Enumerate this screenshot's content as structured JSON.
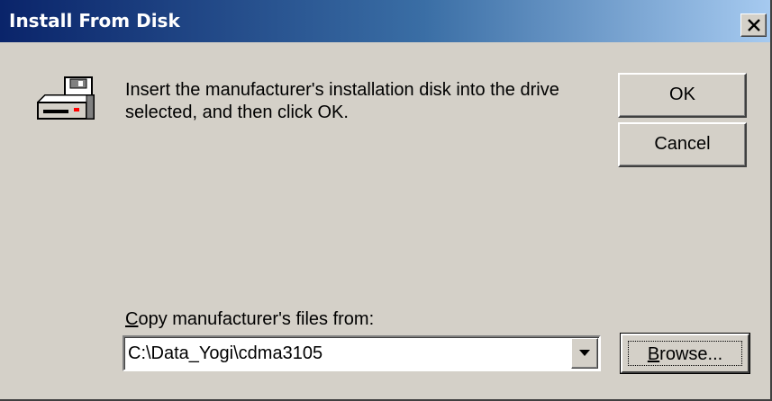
{
  "window": {
    "title": "Install From Disk",
    "close_icon": "close-icon"
  },
  "message": {
    "icon": "floppy-drive-icon",
    "text": "Insert the manufacturer's installation disk into the drive selected, and then click OK."
  },
  "buttons": {
    "ok_label": "OK",
    "cancel_label": "Cancel",
    "browse_label_first": "B",
    "browse_label_rest": "rowse..."
  },
  "copy_from": {
    "label_first": "C",
    "label_rest": "opy manufacturer's files from:",
    "value": "C:\\Data_Yogi\\cdma3105",
    "dropdown_icon": "chevron-down-icon"
  },
  "colors": {
    "titlebar_start": "#0a246a",
    "titlebar_end": "#a6caf0",
    "face": "#d4d0c8"
  }
}
